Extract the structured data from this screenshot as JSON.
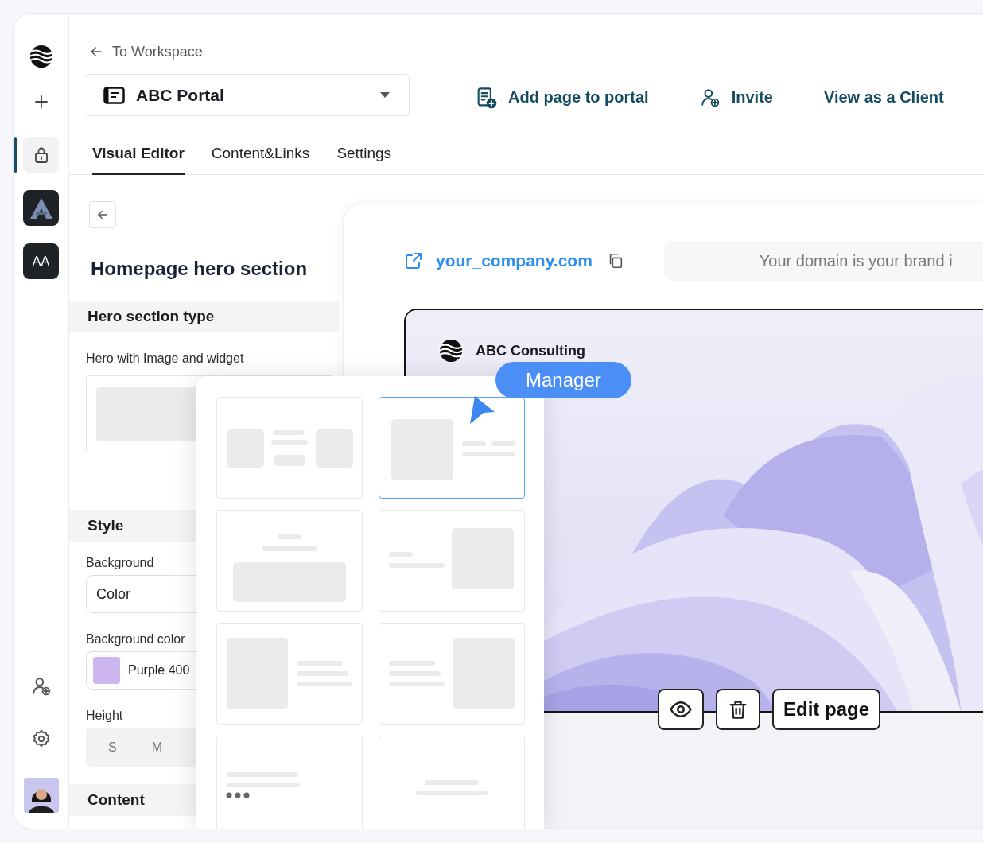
{
  "sidebar": {
    "items": [
      {
        "kind": "add",
        "selected": false
      },
      {
        "kind": "lock",
        "selected": true
      },
      {
        "kind": "app",
        "selected": false
      },
      {
        "kind": "initials",
        "label": "AA",
        "selected": false
      }
    ],
    "bottom_items": [
      {
        "kind": "invite"
      },
      {
        "kind": "settings"
      },
      {
        "kind": "avatar"
      }
    ]
  },
  "header": {
    "back_link": "To Workspace",
    "portal_select": {
      "value": "ABC Portal"
    },
    "actions": [
      {
        "kind": "add-page",
        "label": "Add page to portal"
      },
      {
        "kind": "invite",
        "label": "Invite"
      },
      {
        "kind": "view",
        "label": "View as a Client"
      }
    ]
  },
  "tabs": [
    {
      "label": "Visual Editor",
      "selected": true
    },
    {
      "label": "Content&Links",
      "selected": false
    },
    {
      "label": "Settings",
      "selected": false
    }
  ],
  "editor": {
    "title": "Homepage hero section",
    "hero_type": {
      "heading": "Hero section type",
      "value": "Hero with Image and widget"
    },
    "style": {
      "heading": "Style",
      "background": {
        "label": "Background",
        "value": "Color"
      },
      "background_color": {
        "label": "Background color",
        "value": "Purple 400",
        "color": "#cdb6f0"
      },
      "height": {
        "label": "Height",
        "options": [
          "S",
          "M"
        ]
      }
    },
    "content": {
      "heading": "Content"
    }
  },
  "preview": {
    "link": "your_company.com",
    "domain_hint": "Your domain is your brand i",
    "site": {
      "brand": "ABC Consulting",
      "kind": "picture"
    },
    "badge": "Manager",
    "edit_button": "Edit page"
  },
  "templates": [
    {
      "kind": "split-center",
      "selected": false
    },
    {
      "kind": "image-left-small",
      "selected": true
    },
    {
      "kind": "heading-top",
      "selected": false
    },
    {
      "kind": "text-left",
      "selected": false
    },
    {
      "kind": "image-left",
      "selected": false
    },
    {
      "kind": "image-right",
      "selected": false
    },
    {
      "kind": "text-dots",
      "selected": false
    },
    {
      "kind": "text-center",
      "selected": false
    }
  ]
}
